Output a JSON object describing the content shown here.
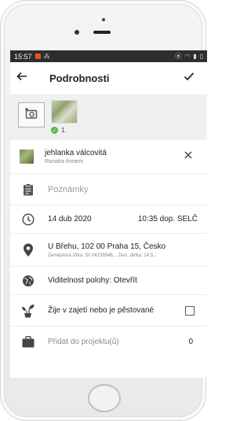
{
  "status_bar": {
    "time": "15:57"
  },
  "app_bar": {
    "title": "Podrobnosti"
  },
  "photo_strip": {
    "photo_index": "1."
  },
  "species": {
    "common_name": "jehlanka válcovitá",
    "latin_name": "Ranatra linearis"
  },
  "notes": {
    "placeholder": "Poznámky"
  },
  "observed_on": {
    "date": "14 dub 2020",
    "time": "10:35 dop. SELČ"
  },
  "place": {
    "address": "U Břehu, 102 00 Praha 15, Česko",
    "coordinates": "Zeměpisná šířka: 50.04159548...   Zem. délka: 14.5..."
  },
  "geoprivacy": {
    "label": "Viditelnost polohy: Otevřít"
  },
  "captive": {
    "label": "Žije v zajetí nebo je pěstované",
    "checked": false
  },
  "projects": {
    "label": "Přidat do projektu(ů)",
    "count": "0"
  },
  "colors": {
    "status_bar": "#2e2e2e",
    "photo_strip_bg": "#f0f0f0",
    "success_green": "#53b848",
    "notification_orange": "#e8502a"
  },
  "icons": {
    "back": "arrow-left-icon",
    "save": "checkmark-icon",
    "add_photo": "camera-plus-icon",
    "remove_species": "close-icon",
    "notes": "clipboard-icon",
    "date": "clock-icon",
    "place": "map-pin-icon",
    "geoprivacy": "globe-icon",
    "captive": "potted-plant-icon",
    "projects": "briefcase-icon"
  }
}
